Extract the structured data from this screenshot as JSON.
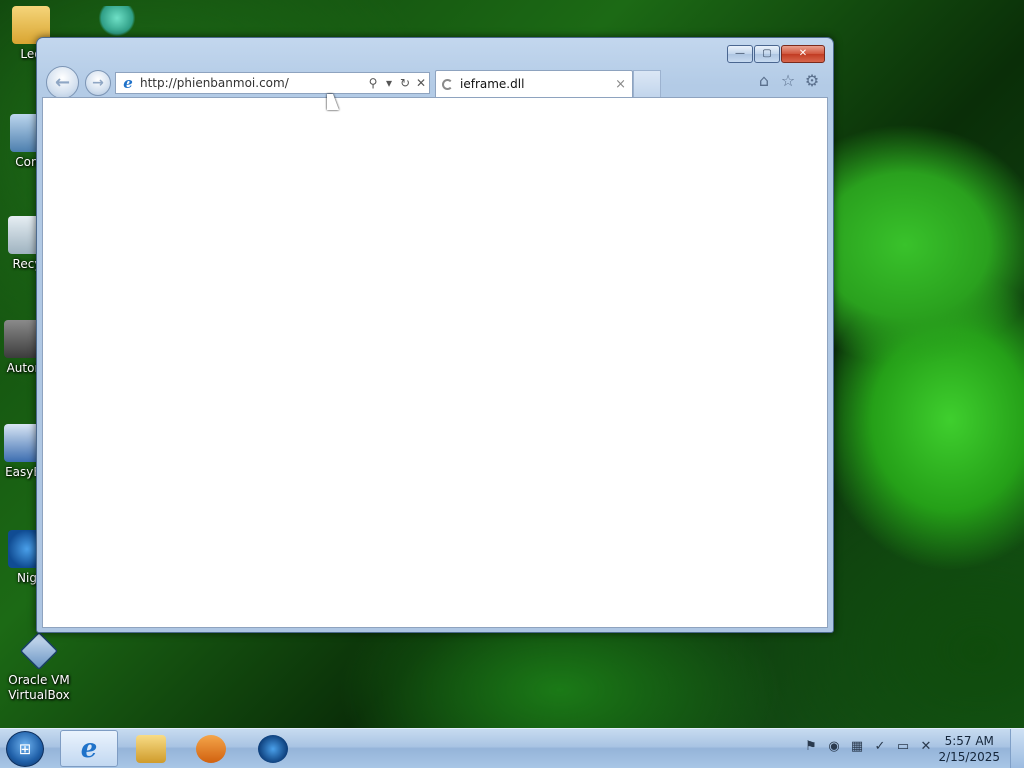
{
  "desktop": {
    "icons": [
      {
        "label": "Leo",
        "icon": "folder-icon"
      },
      {
        "label": "",
        "icon": "dragon-app-icon"
      },
      {
        "label": "Com",
        "icon": "computer-icon"
      },
      {
        "label": "Recy",
        "icon": "recycle-bin-icon"
      },
      {
        "label": "Autor",
        "icon": "autoruns-icon"
      },
      {
        "label": "EasyE",
        "icon": "easy-app-icon"
      },
      {
        "label": "Nig",
        "icon": "night-app-icon"
      },
      {
        "label": "Oracle VM VirtualBox",
        "icon": "virtualbox-icon"
      }
    ]
  },
  "browser": {
    "caption": {
      "minimize": "—",
      "maximize": "▢",
      "close": "✕"
    },
    "address_url": "http://phienbanmoi.com/",
    "address_buttons": {
      "search": "⚲",
      "dropdown": "▾",
      "refresh": "↻",
      "stop": "✕"
    },
    "tab": {
      "title": "ieframe.dll",
      "close": "×"
    },
    "tools": {
      "home": "⌂",
      "favorites": "☆",
      "settings": "⚙"
    }
  },
  "taskbar": {
    "start": "⊞",
    "apps": [
      "internet-explorer",
      "windows-explorer",
      "media-player",
      "night-app"
    ],
    "tray_icons": [
      "action-center-icon",
      "network-icon",
      "app-tray-icon",
      "security-icon",
      "display-icon",
      "volume-muted-icon"
    ],
    "clock": {
      "time": "5:57 AM",
      "date": "2/15/2025"
    }
  }
}
